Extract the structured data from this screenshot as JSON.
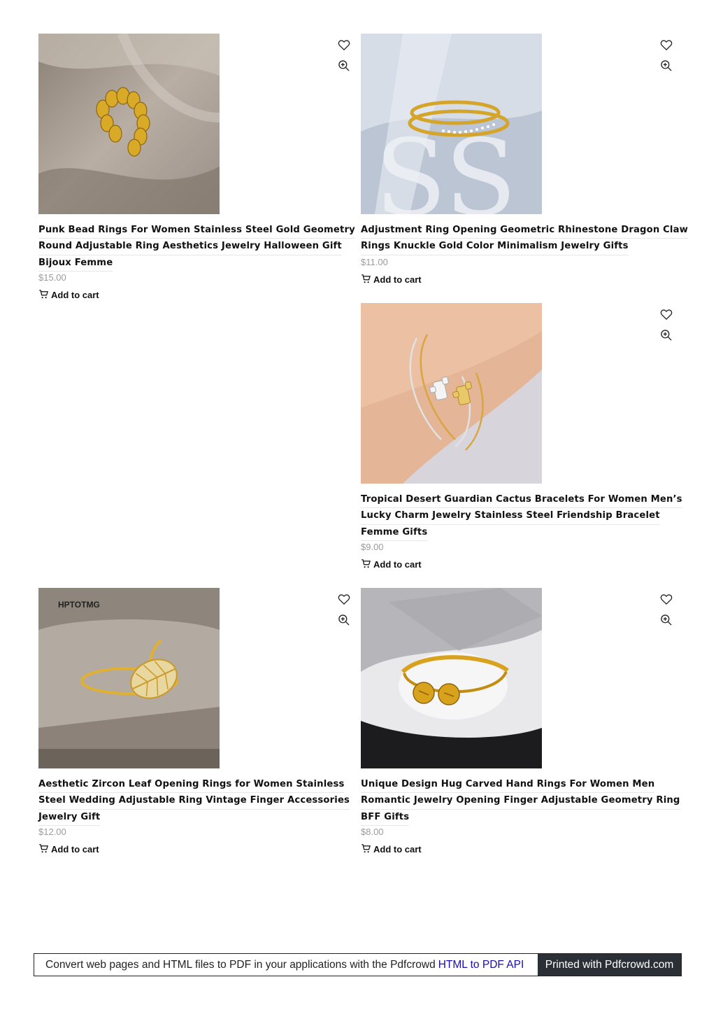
{
  "products": [
    {
      "title_lines": [
        "Punk Bead Rings For Women Stainless Steel Gold Geometry",
        "Round Adjustable Ring Aesthetics Jewelry Halloween Gift",
        "Bijoux Femme"
      ],
      "price": "$15.00",
      "cta": "Add to cart"
    },
    {
      "title_lines": [
        "Adjustment Ring Opening Geometric Rhinestone Dragon Claw",
        "Rings Knuckle Gold Color Minimalism Jewelry Gifts"
      ],
      "price": "$11.00",
      "cta": "Add to cart"
    },
    {
      "title_lines": [
        "Tropical Desert Guardian Cactus Bracelets For Women Men’s",
        "Lucky Charm Jewelry Stainless Steel Friendship Bracelet",
        "Femme Gifts"
      ],
      "price": "$9.00",
      "cta": "Add to cart"
    },
    {
      "title_lines": [
        "Aesthetic Zircon Leaf Opening Rings for Women Stainless",
        "Steel Wedding Adjustable Ring Vintage Finger Accessories",
        "Jewelry Gift"
      ],
      "price": "$12.00",
      "cta": "Add to cart",
      "image_watermark": "HPTOTMG"
    },
    {
      "title_lines": [
        "Unique Design Hug Carved Hand Rings For Women Men",
        "Romantic Jewelry Opening Finger Adjustable Geometry Ring",
        "BFF Gifts"
      ],
      "price": "$8.00",
      "cta": "Add to cart"
    }
  ],
  "icons": {
    "wishlist": "heart-icon",
    "quick_view": "zoom-in-icon",
    "cart": "cart-icon"
  },
  "footer": {
    "text": "Convert web pages and HTML files to PDF in your applications with the Pdfcrowd",
    "link": "HTML to PDF API",
    "badge": "Printed with Pdfcrowd.com"
  }
}
